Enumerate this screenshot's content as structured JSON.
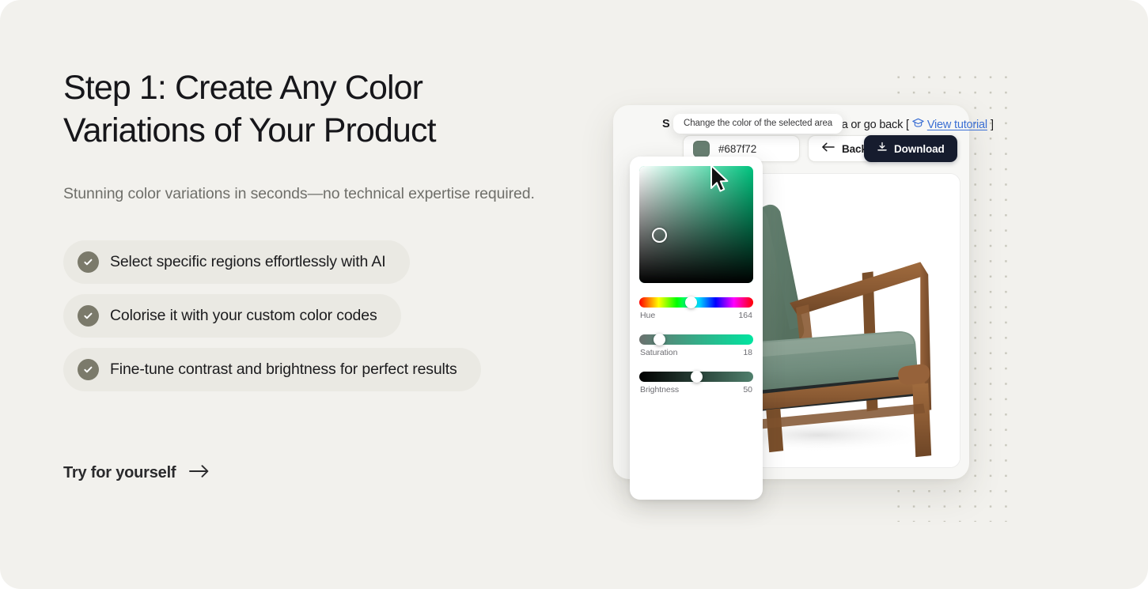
{
  "hero": {
    "headline": "Step 1: Create Any Color Variations of Your Product",
    "subhead": "Stunning color variations in seconds—no technical expertise required.",
    "features": [
      {
        "label": "Select specific regions effortlessly with AI",
        "icon": "check-circle-icon"
      },
      {
        "label": "Colorise it with your custom color codes",
        "icon": "check-circle-icon"
      },
      {
        "label": "Fine-tune contrast and brightness for perfect results",
        "icon": "check-circle-icon"
      }
    ],
    "cta": {
      "label": "Try for yourself",
      "icon": "arrow-right-icon"
    }
  },
  "app": {
    "toolbar": {
      "hint_prefix": "S",
      "hint_tail": "ted area or go back  [",
      "tutorial_icon": "graduation-cap-icon",
      "tutorial_link": "View tutorial",
      "hint_close": "]",
      "tooltip": "Change the color of the selected area"
    },
    "controls": {
      "hex_value": "#687f72",
      "hex_swatch_color": "#687f72",
      "back_label": "Back",
      "back_icon": "arrow-left-icon",
      "download_label": "Download",
      "download_icon": "download-icon",
      "download_bg": "#161c2e"
    },
    "picker": {
      "sv_base_color": "#00c47f",
      "sliders": [
        {
          "name": "Hue",
          "value": "164",
          "percent": 45.5,
          "track": "hue-gradient"
        },
        {
          "name": "Saturation",
          "value": "18",
          "percent": 18,
          "track": "saturation-gradient"
        },
        {
          "name": "Brightness",
          "value": "50",
          "percent": 50,
          "track": "brightness-gradient"
        }
      ]
    },
    "preview": {
      "product": "armchair",
      "upholstery_color": "#6e8b7c",
      "wood_color": "#8a5a33"
    }
  },
  "theme": {
    "page_bg": "#f2f1ed",
    "pill_bg": "#eae9e3",
    "check_bg": "#7b7a6b",
    "link_blue": "#3b6fd4",
    "dot_color": "#c9c8bd"
  }
}
